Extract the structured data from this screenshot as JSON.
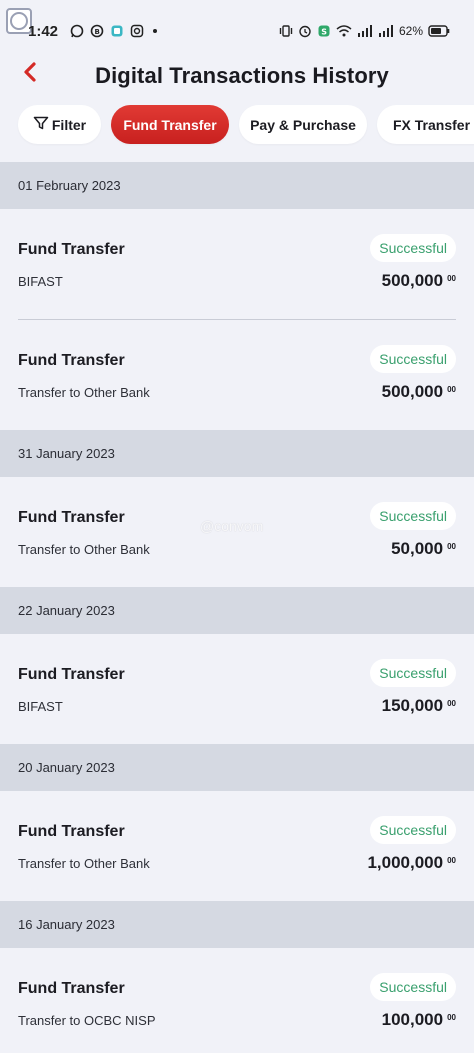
{
  "status_bar": {
    "time": "1:42",
    "battery": "62%",
    "left_icons": [
      "whatsapp-icon",
      "whatsapp-business-icon",
      "chat-icon",
      "instagram-icon",
      "dot-icon"
    ],
    "right_icons": [
      "vibrate-icon",
      "alarm-icon",
      "vpn-icon",
      "wifi-icon",
      "signal-icon",
      "signal-icon",
      "battery-icon"
    ]
  },
  "header": {
    "title": "Digital Transactions History",
    "back_icon": "chevron-left-icon"
  },
  "chips": [
    {
      "label": "Filter",
      "icon": "filter-icon",
      "active": false
    },
    {
      "label": "Fund Transfer",
      "active": true
    },
    {
      "label": "Pay & Purchase",
      "active": false
    },
    {
      "label": "FX Transfer",
      "active": false
    }
  ],
  "watermark": "@convom",
  "groups": [
    {
      "date": "01 February 2023",
      "items": [
        {
          "title": "Fund Transfer",
          "subtitle": "BIFAST",
          "status": "Successful",
          "amount": "500,000",
          "cents": "00"
        },
        {
          "title": "Fund Transfer",
          "subtitle": "Transfer to Other Bank",
          "status": "Successful",
          "amount": "500,000",
          "cents": "00"
        }
      ]
    },
    {
      "date": "31 January 2023",
      "items": [
        {
          "title": "Fund Transfer",
          "subtitle": "Transfer to Other Bank",
          "status": "Successful",
          "amount": "50,000",
          "cents": "00"
        }
      ]
    },
    {
      "date": "22 January 2023",
      "items": [
        {
          "title": "Fund Transfer",
          "subtitle": "BIFAST",
          "status": "Successful",
          "amount": "150,000",
          "cents": "00"
        }
      ]
    },
    {
      "date": "20 January 2023",
      "items": [
        {
          "title": "Fund Transfer",
          "subtitle": "Transfer to Other Bank",
          "status": "Successful",
          "amount": "1,000,000",
          "cents": "00"
        }
      ]
    },
    {
      "date": "16 January 2023",
      "items": [
        {
          "title": "Fund Transfer",
          "subtitle": "Transfer to OCBC NISP",
          "status": "Successful",
          "amount": "100,000",
          "cents": "00"
        }
      ]
    }
  ],
  "colors": {
    "accent": "#d42a26",
    "success": "#3aa06e",
    "date_header_bg": "#d5d9e2",
    "page_bg": "#f1f2f8"
  }
}
